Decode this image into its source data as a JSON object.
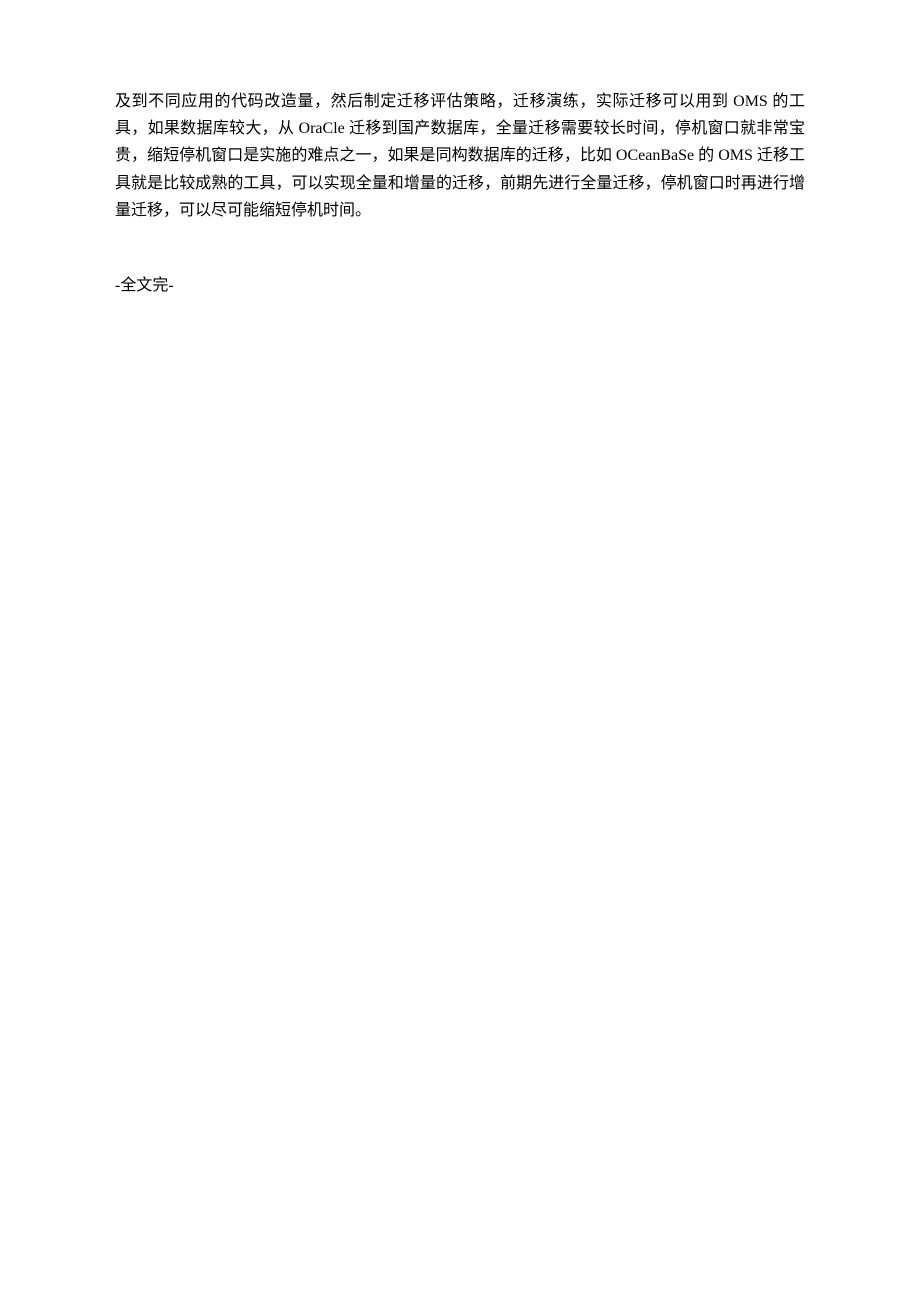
{
  "document": {
    "paragraph1": "及到不同应用的代码改造量，然后制定迁移评估策略，迁移演练，实际迁移可以用到 OMS 的工具，如果数据库较大，从 OraCle 迁移到国产数据库，全量迁移需要较长时间，停机窗口就非常宝贵，缩短停机窗口是实施的难点之一，如果是同构数据库的迁移，比如 OCeanBaSe 的 OMS 迁移工具就是比较成熟的工具，可以实现全量和增量的迁移，前期先进行全量迁移，停机窗口时再进行增量迁移，可以尽可能缩短停机时间。",
    "footer": "-全文完-"
  }
}
